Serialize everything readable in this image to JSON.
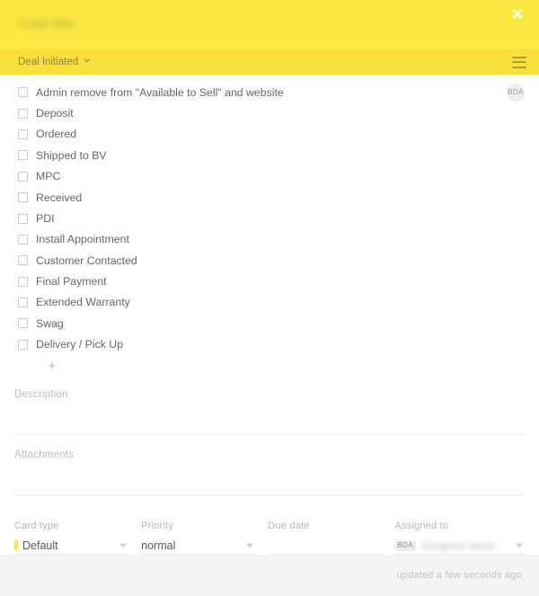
{
  "header": {
    "title": "Card title",
    "title_redacted": true,
    "close_label": "✕",
    "background_color": "#FAE843"
  },
  "toolbar": {
    "list_name": "Deal Initiated",
    "chevron_icon": "chevron-down-icon",
    "menu_icon": "hamburger-menu-icon",
    "background_color": "#F7E03C"
  },
  "checklist": {
    "items": [
      {
        "label": "Admin remove from \"Available to Sell\" and website",
        "checked": false,
        "badge": "BDA"
      },
      {
        "label": "Deposit",
        "checked": false,
        "badge": ""
      },
      {
        "label": "Ordered",
        "checked": false,
        "badge": ""
      },
      {
        "label": "Shipped to BV",
        "checked": false,
        "badge": ""
      },
      {
        "label": "MPC",
        "checked": false,
        "badge": ""
      },
      {
        "label": "Received",
        "checked": false,
        "badge": ""
      },
      {
        "label": "PDI",
        "checked": false,
        "badge": ""
      },
      {
        "label": "Install Appointment",
        "checked": false,
        "badge": ""
      },
      {
        "label": "Customer Contacted",
        "checked": false,
        "badge": ""
      },
      {
        "label": "Final Payment",
        "checked": false,
        "badge": ""
      },
      {
        "label": "Extended Warranty",
        "checked": false,
        "badge": ""
      },
      {
        "label": "Swag",
        "checked": false,
        "badge": ""
      },
      {
        "label": "Delivery / Pick Up",
        "checked": false,
        "badge": ""
      }
    ],
    "add_label": "+"
  },
  "sections": {
    "description": {
      "label": "Description",
      "value": ""
    },
    "attachments": {
      "label": "Attachments",
      "value": ""
    }
  },
  "meta": {
    "card_type": {
      "label": "Card type",
      "value": "Default",
      "swatch_color": "#FAE843",
      "caret_icon": "caret-down-icon"
    },
    "priority": {
      "label": "Priority",
      "value": "normal",
      "caret_icon": "caret-down-icon"
    },
    "due_date": {
      "label": "Due date",
      "value": ""
    },
    "assigned_to": {
      "label": "Assigned to",
      "badge": "BDA",
      "value": "Assignee name",
      "value_redacted": true,
      "caret_icon": "caret-down-icon"
    }
  },
  "footer": {
    "updated_text": "updated a few seconds ago",
    "background_color": "#F4F4F4"
  }
}
